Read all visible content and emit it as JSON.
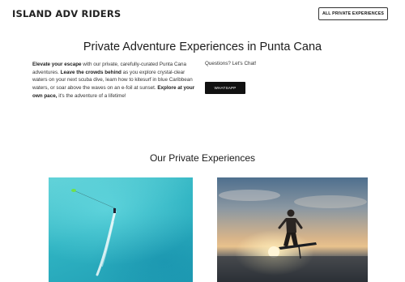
{
  "header": {
    "brand": "ISLAND ADV RIDERS",
    "nav_button": "ALL PRIVATE EXPERIENCES"
  },
  "hero": {
    "title": "Private Adventure Experiences in Punta Cana",
    "intro": {
      "lead_bold": "Elevate your escape",
      "text1": " with our private, carefully-curated Punta Cana adventures.  ",
      "mid_bold": "Leave the crowds behind",
      "text2": " as you explore crystal-clear waters on your next scuba dive, learn how to kitesurf in blue Caribbean waters, or soar above the waves on an e-foil at sunset. ",
      "end_bold": "Explore at your own pace,",
      "text3": " it's the adventure of a lifetime!"
    },
    "chat_label": "Questions? Let's Chat!",
    "whatsapp_button": "WHATSAPP"
  },
  "experiences": {
    "title": "Our Private Experiences"
  },
  "colors": {
    "button_dark": "#111111",
    "sea": "#2fb3c2",
    "sunset": "#e9c28d"
  }
}
